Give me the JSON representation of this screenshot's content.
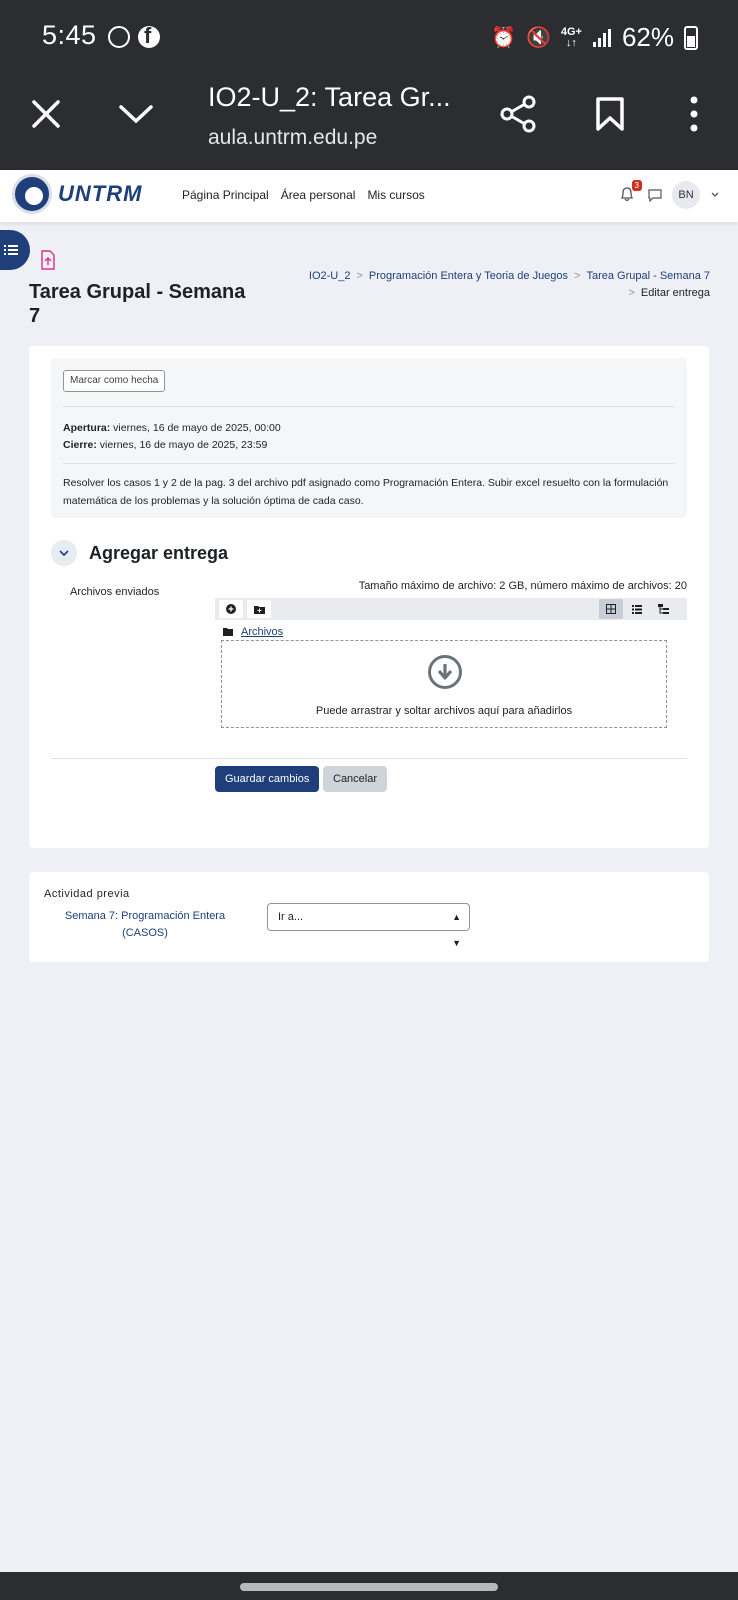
{
  "status_bar": {
    "time": "5:45",
    "network": "4G+",
    "battery": "62%",
    "icons": [
      "whatsapp-icon",
      "facebook-icon",
      "alarm-icon",
      "mute-icon",
      "signal-icon",
      "battery-icon"
    ]
  },
  "browser": {
    "tab_title": "IO2-U_2: Tarea Gr...",
    "url": "aula.untrm.edu.pe",
    "buttons": [
      "close-icon",
      "chevron-down-icon",
      "share-icon",
      "bookmark-icon",
      "more-vertical-icon"
    ]
  },
  "navbar": {
    "logo_text": "UNTRM",
    "links": [
      "Página Principal",
      "Área personal",
      "Mis cursos"
    ],
    "notification_count": "3",
    "avatar_initials": "BN"
  },
  "page": {
    "title": "Tarea Grupal - Semana 7",
    "breadcrumb": [
      "IO2-U_2",
      "Programación Entera y Teoria de Juegos",
      "Tarea Grupal - Semana 7",
      "Editar entrega"
    ]
  },
  "assignment": {
    "mark_done_label": "Marcar como hecha",
    "opening_label": "Apertura:",
    "opening_value": " viernes, 16 de mayo de 2025, 00:00",
    "closing_label": "Cierre:",
    "closing_value": " viernes, 16 de mayo de 2025, 23:59",
    "description": "Resolver los casos 1 y 2 de la pag. 3 del archivo pdf asignado como Programación Entera. Subir excel resuelto con la formulación matemática de los problemas y la solución óptima de cada caso."
  },
  "submission": {
    "section_title": "Agregar entrega",
    "field_label": "Archivos enviados",
    "limits": "Tamaño máximo de archivo: 2 GB, número máximo de archivos: 20",
    "folder_link": "Archivos",
    "drop_text": "Puede arrastrar y soltar archivos aquí para añadirlos",
    "save_label": "Guardar cambios",
    "cancel_label": "Cancelar"
  },
  "previous_activity": {
    "heading": "Actividad previa",
    "link": "Semana 7: Programación Entera (CASOS)",
    "jump_placeholder": "Ir a..."
  },
  "colors": {
    "brand": "#1f3f7a",
    "chrome": "#2b2d31",
    "page_bg": "#eef0f5"
  }
}
